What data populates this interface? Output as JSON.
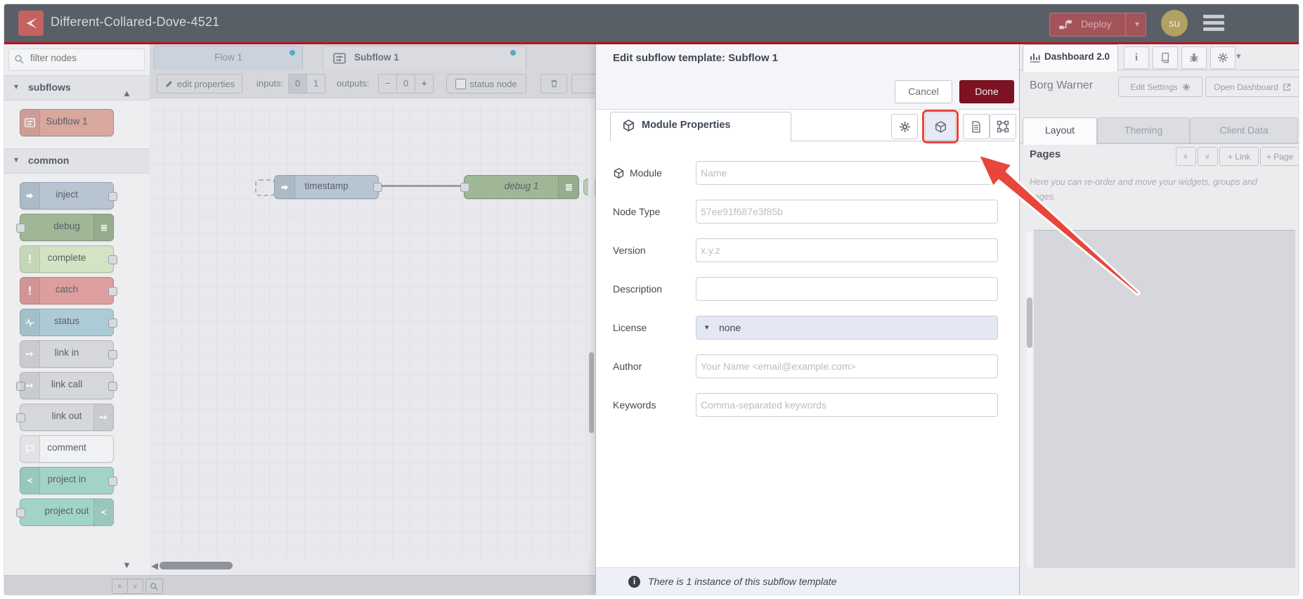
{
  "colors": {
    "header_bg": "#585f66",
    "brand_red": "#b4151f",
    "deploy_red": "#a4535a",
    "done_red": "#7d1322",
    "annotation_red": "#e8453c",
    "modified_dot_blue": "#58a8c8"
  },
  "header": {
    "title": "Different-Collared-Dove-4521",
    "deploy_label": "Deploy",
    "avatar": "su"
  },
  "palette": {
    "search_placeholder": "filter nodes",
    "categories": [
      {
        "label": "subflows",
        "items": [
          {
            "label": "Subflow 1",
            "color": "#d8a79e",
            "border": "#ae8a81",
            "icon": "subflow-icon",
            "icon_side": "left",
            "ports": "none"
          }
        ]
      },
      {
        "label": "common",
        "items": [
          {
            "label": "inject",
            "color": "#b7c5d2",
            "border": "#93a5b5",
            "icon": "inject-icon",
            "icon_side": "left",
            "ports": "right"
          },
          {
            "label": "debug",
            "color": "#9fb797",
            "border": "#81997a",
            "icon": "debug-icon",
            "icon_side": "right",
            "ports": "left"
          },
          {
            "label": "complete",
            "color": "#d2e4c4",
            "border": "#a9c09a",
            "icon": "exclamation-icon",
            "icon_side": "left",
            "ports": "right"
          },
          {
            "label": "catch",
            "color": "#dd9f9e",
            "border": "#bb8281",
            "icon": "exclamation-icon",
            "icon_side": "left",
            "ports": "right"
          },
          {
            "label": "status",
            "color": "#adcbd6",
            "border": "#8cacb9",
            "icon": "status-icon",
            "icon_side": "left",
            "ports": "right"
          },
          {
            "label": "link in",
            "color": "#d5d7da",
            "border": "#b2b5b9",
            "icon": "link-icon",
            "icon_side": "left",
            "ports": "right"
          },
          {
            "label": "link call",
            "color": "#d5d7da",
            "border": "#b2b5b9",
            "icon": "link-icon",
            "icon_side": "left",
            "ports": "both"
          },
          {
            "label": "link out",
            "color": "#d5d7da",
            "border": "#b2b5b9",
            "icon": "link-icon",
            "icon_side": "right",
            "ports": "left"
          },
          {
            "label": "comment",
            "color": "#f0f1f3",
            "border": "#c6c8cc",
            "icon": "comment-icon",
            "icon_side": "left",
            "ports": "none"
          },
          {
            "label": "project in",
            "color": "#a2d3c7",
            "border": "#83b4a8",
            "icon": "node-red-icon",
            "icon_side": "left",
            "ports": "right"
          },
          {
            "label": "project out",
            "color": "#a2d3c7",
            "border": "#83b4a8",
            "icon": "node-red-icon",
            "icon_side": "right",
            "ports": "left"
          }
        ]
      }
    ]
  },
  "workspace": {
    "tabs": [
      {
        "label": "Flow 1"
      },
      {
        "label": "Subflow 1"
      }
    ],
    "toolbar": {
      "edit_properties": "edit properties",
      "inputs_label": "inputs:",
      "input_options": [
        "0",
        "1"
      ],
      "input_selected": "0",
      "outputs_label": "outputs:",
      "minus": "−",
      "output_value": "0",
      "plus": "+",
      "status_node": "status node"
    },
    "nodes": {
      "timestamp": "timestamp",
      "debug": "debug 1"
    }
  },
  "tray": {
    "title": "Edit subflow template: Subflow 1",
    "cancel": "Cancel",
    "done": "Done",
    "properties_tab": "Module Properties",
    "fields": [
      {
        "label": "Module",
        "placeholder": "Name",
        "type": "text",
        "icon": "cube-icon"
      },
      {
        "label": "Node Type",
        "placeholder": "57ee91f687e3f85b",
        "type": "text"
      },
      {
        "label": "Version",
        "placeholder": "x.y.z",
        "type": "text"
      },
      {
        "label": "Description",
        "placeholder": "",
        "type": "text"
      },
      {
        "label": "License",
        "value": "none",
        "type": "select"
      },
      {
        "label": "Author",
        "placeholder": "Your Name <email@example.com>",
        "type": "text"
      },
      {
        "label": "Keywords",
        "placeholder": "Comma-separated keywords",
        "type": "text"
      }
    ],
    "footer": "There is 1 instance of this subflow template"
  },
  "sidebar": {
    "dashboard_tab": "Dashboard 2.0",
    "owner": "Borg Warner",
    "edit_settings": "Edit Settings",
    "open_dashboard": "Open Dashboard",
    "tabs": [
      "Layout",
      "Theming",
      "Client Data"
    ],
    "active_tab": "Layout",
    "pages_title": "Pages",
    "add_link": "+ Link",
    "add_page": "+ Page",
    "hint": "Here you can re-order and move your widgets, groups and pages."
  }
}
